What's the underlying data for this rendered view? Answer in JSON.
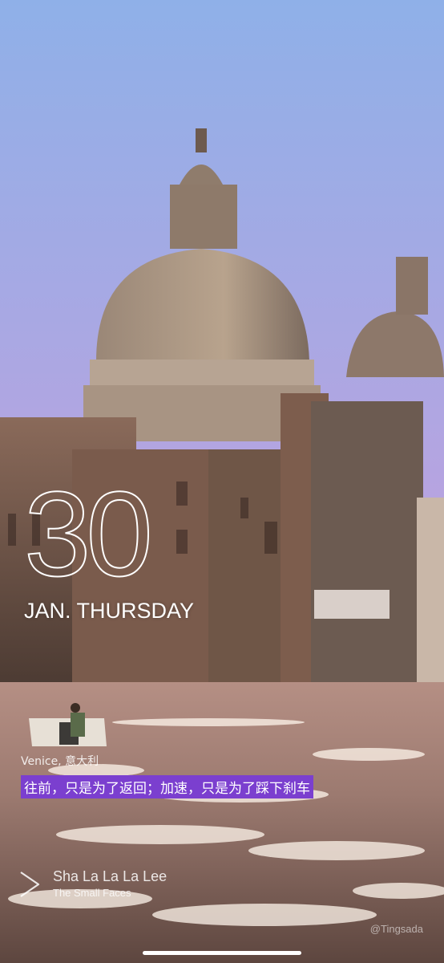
{
  "date": {
    "day_number": "30",
    "month_weekday": "JAN. THURSDAY"
  },
  "caption": {
    "location": "Venice, 意大利",
    "quote": "往前，只是为了返回；加速，只是为了踩下刹车"
  },
  "music": {
    "icon": "play-icon",
    "title": "Sha La La La Lee",
    "artist": "The Small Faces"
  },
  "watermark": "@Tingsada",
  "colors": {
    "quote_highlight": "#7b3fcf",
    "sky_top": "#9fb4e6",
    "sky_bottom": "#c9a6d6",
    "text": "#ffffff"
  }
}
